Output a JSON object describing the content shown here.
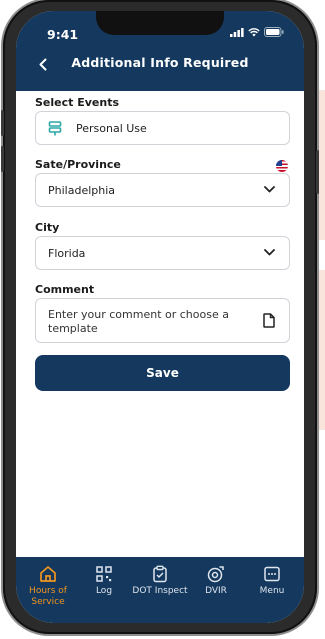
{
  "status_bar": {
    "time": "9:41"
  },
  "header": {
    "title": "Additional Info Required"
  },
  "form": {
    "events_label": "Select Events",
    "events_value": "Personal Use",
    "state_label": "Sate/Province",
    "state_value": "Philadelphia",
    "city_label": "City",
    "city_value": "Florida",
    "comment_label": "Comment",
    "comment_placeholder": "Enter your comment or choose a template",
    "save_label": "Save"
  },
  "tabbar": {
    "items": [
      {
        "label": "Hours of Service",
        "icon": "home-icon",
        "active": true
      },
      {
        "label": "Log",
        "icon": "qr-code-icon",
        "active": false
      },
      {
        "label": "DOT Inspect",
        "icon": "clipboard-icon",
        "active": false
      },
      {
        "label": "DVIR",
        "icon": "tire-icon",
        "active": false
      },
      {
        "label": "Menu",
        "icon": "menu-icon",
        "active": false
      }
    ]
  },
  "colors": {
    "primary": "#14385e",
    "accent": "#f0951f",
    "border": "#d0d4d9"
  }
}
